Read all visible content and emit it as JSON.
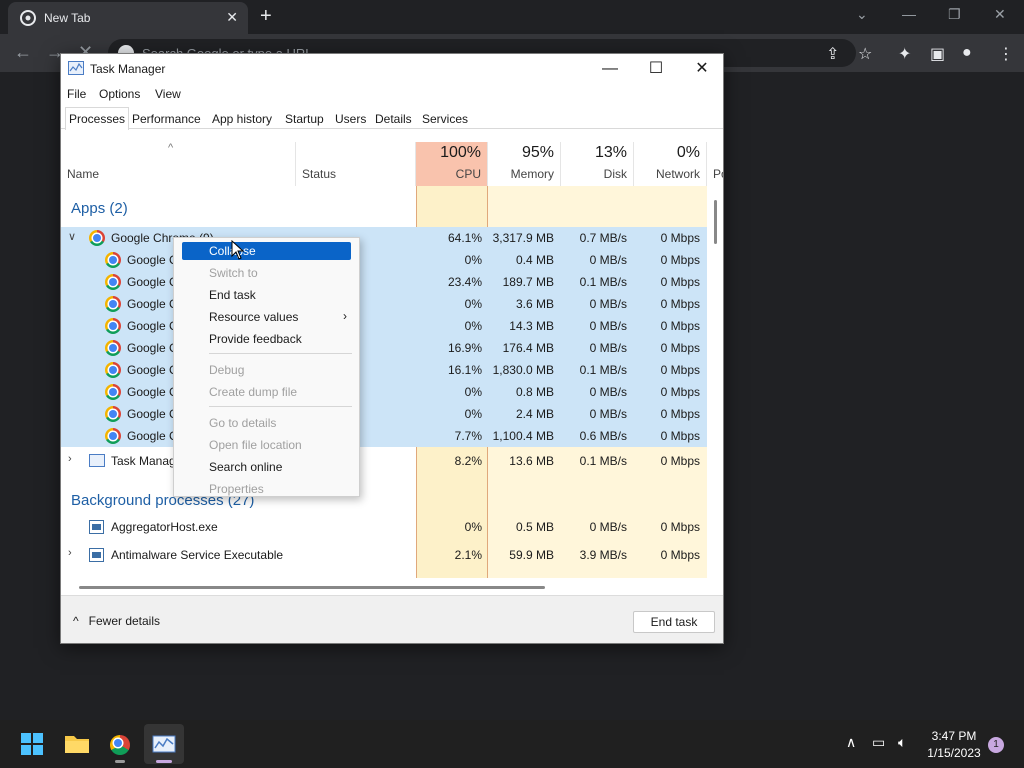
{
  "browser": {
    "tab_title": "New Tab",
    "omnibox_placeholder": "Search Google or type a URL"
  },
  "task_manager": {
    "title": "Task Manager",
    "menu": [
      "File",
      "Options",
      "View"
    ],
    "tabs": [
      "Processes",
      "Performance",
      "App history",
      "Startup",
      "Users",
      "Details",
      "Services"
    ],
    "active_tab": "Processes",
    "columns": {
      "name": "Name",
      "status": "Status",
      "cpu": {
        "pct": "100%",
        "label": "CPU"
      },
      "memory": {
        "pct": "95%",
        "label": "Memory"
      },
      "disk": {
        "pct": "13%",
        "label": "Disk"
      },
      "network": {
        "pct": "0%",
        "label": "Network"
      },
      "extra": "Po"
    },
    "apps_group": "Apps (2)",
    "background_group": "Background processes (27)",
    "rows": [
      {
        "name": "Google Chrome (9)",
        "cpu": "64.1%",
        "mem": "3,317.9 MB",
        "disk": "0.7 MB/s",
        "net": "0 Mbps"
      },
      {
        "name": "Google Chrome",
        "cpu": "0%",
        "mem": "0.4 MB",
        "disk": "0 MB/s",
        "net": "0 Mbps"
      },
      {
        "name": "Google Chrome",
        "cpu": "23.4%",
        "mem": "189.7 MB",
        "disk": "0.1 MB/s",
        "net": "0 Mbps"
      },
      {
        "name": "Google Chrome",
        "cpu": "0%",
        "mem": "3.6 MB",
        "disk": "0 MB/s",
        "net": "0 Mbps"
      },
      {
        "name": "Google Chrome",
        "cpu": "0%",
        "mem": "14.3 MB",
        "disk": "0 MB/s",
        "net": "0 Mbps"
      },
      {
        "name": "Google Chrome",
        "cpu": "16.9%",
        "mem": "176.4 MB",
        "disk": "0 MB/s",
        "net": "0 Mbps"
      },
      {
        "name": "Google Chrome",
        "cpu": "16.1%",
        "mem": "1,830.0 MB",
        "disk": "0.1 MB/s",
        "net": "0 Mbps"
      },
      {
        "name": "Google Chrome",
        "cpu": "0%",
        "mem": "0.8 MB",
        "disk": "0 MB/s",
        "net": "0 Mbps"
      },
      {
        "name": "Google Chrome",
        "cpu": "0%",
        "mem": "2.4 MB",
        "disk": "0 MB/s",
        "net": "0 Mbps"
      },
      {
        "name": "Google Chrome",
        "cpu": "7.7%",
        "mem": "1,100.4 MB",
        "disk": "0.6 MB/s",
        "net": "0 Mbps"
      },
      {
        "name": "Task Manager",
        "cpu": "8.2%",
        "mem": "13.6 MB",
        "disk": "0.1 MB/s",
        "net": "0 Mbps"
      },
      {
        "name": "AggregatorHost.exe",
        "cpu": "0%",
        "mem": "0.5 MB",
        "disk": "0 MB/s",
        "net": "0 Mbps"
      },
      {
        "name": "Antimalware Service Executable",
        "cpu": "2.1%",
        "mem": "59.9 MB",
        "disk": "3.9 MB/s",
        "net": "0 Mbps"
      }
    ],
    "fewer_details": "Fewer details",
    "end_task": "End task"
  },
  "context_menu": {
    "collapse": "Collapse",
    "switch_to": "Switch to",
    "end_task": "End task",
    "resource_values": "Resource values",
    "provide_feedback": "Provide feedback",
    "debug": "Debug",
    "create_dump": "Create dump file",
    "go_to_details": "Go to details",
    "open_file_location": "Open file location",
    "search_online": "Search online",
    "properties": "Properties"
  },
  "taskbar": {
    "time": "3:47 PM",
    "date": "1/15/2023",
    "notifications": "1"
  },
  "colors": {
    "cpu_header": "#f9c3ad",
    "selection": "#cce4f7",
    "menu_highlight": "#0a64c8",
    "group_title": "#1e5fa5"
  }
}
